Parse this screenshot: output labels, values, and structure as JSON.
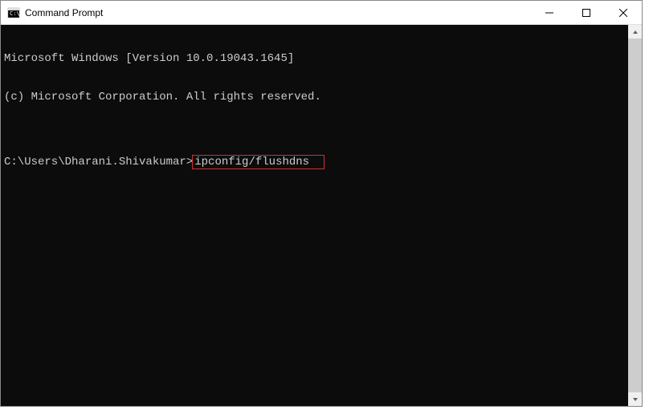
{
  "window": {
    "title": "Command Prompt"
  },
  "terminal": {
    "line1": "Microsoft Windows [Version 10.0.19043.1645]",
    "line2": "(c) Microsoft Corporation. All rights reserved.",
    "blank": "",
    "prompt": "C:\\Users\\Dharani.Shivakumar>",
    "command": "ipconfig/flushdns"
  }
}
